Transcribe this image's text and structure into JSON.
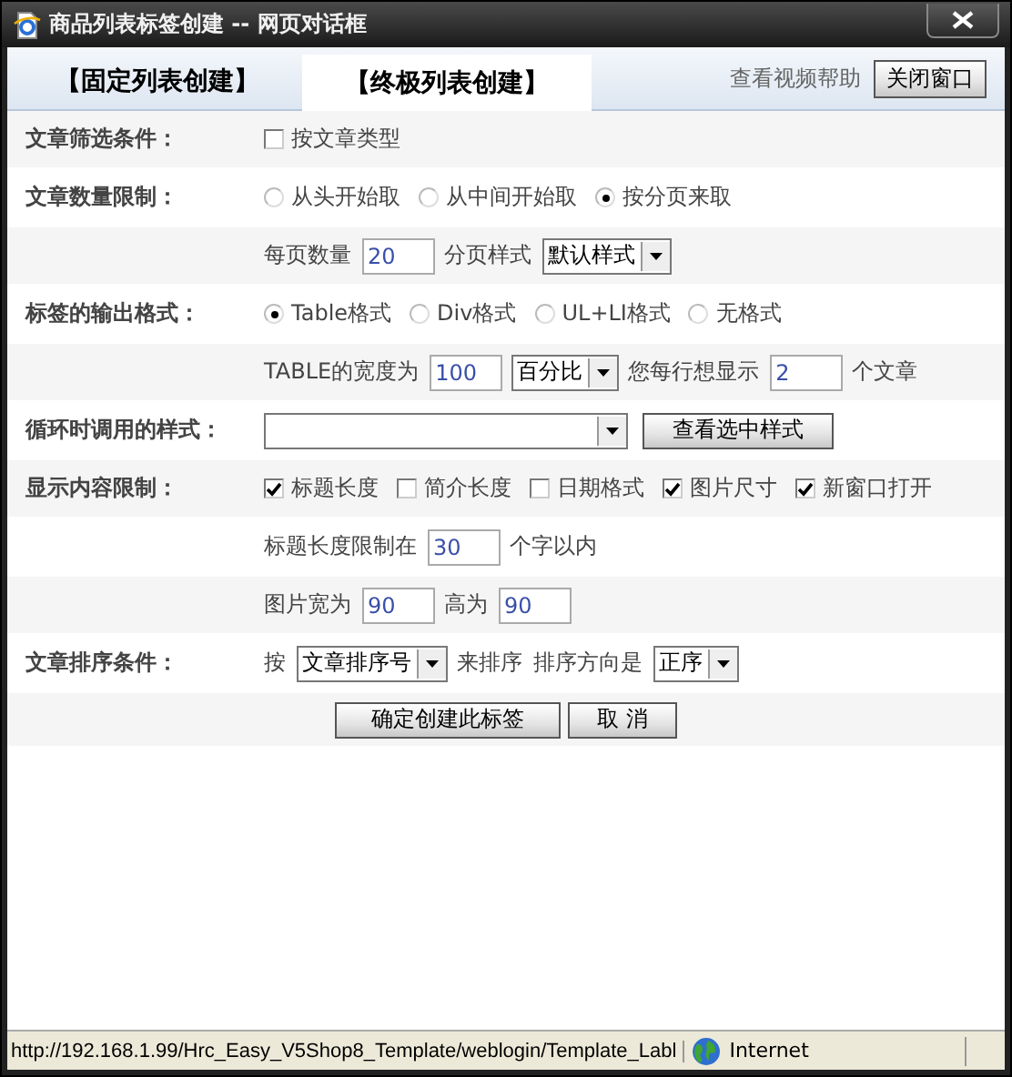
{
  "window": {
    "title": "商品列表标签创建 -- 网页对话框"
  },
  "tabs": [
    {
      "label": "【固定列表创建】",
      "selected": false
    },
    {
      "label": "【终极列表创建】",
      "selected": true
    }
  ],
  "help_link": "查看视频帮助",
  "close_window_button": "关闭窗口",
  "form_rows": [
    {
      "label": "文章筛选条件：",
      "items": [
        {
          "kind": "checkbox",
          "label": "按文章类型",
          "checked": false
        }
      ]
    },
    {
      "label": "文章数量限制：",
      "items": [
        {
          "kind": "radio",
          "label": "从头开始取",
          "selected": false
        },
        {
          "kind": "radio",
          "label": "从中间开始取",
          "selected": false
        },
        {
          "kind": "radio",
          "label": "按分页来取",
          "selected": true
        }
      ]
    },
    {
      "items": [
        {
          "kind": "text",
          "text": "每页数量"
        },
        {
          "kind": "input",
          "value": "20"
        },
        {
          "kind": "text",
          "text": "分页样式"
        },
        {
          "kind": "select",
          "value": "默认样式"
        }
      ]
    },
    {
      "label": "标签的输出格式：",
      "items": [
        {
          "kind": "radio",
          "label": "Table格式",
          "selected": true
        },
        {
          "kind": "radio",
          "label": "Div格式",
          "selected": false
        },
        {
          "kind": "radio",
          "label": "UL+LI格式",
          "selected": false
        },
        {
          "kind": "radio",
          "label": "无格式",
          "selected": false
        }
      ]
    },
    {
      "items": [
        {
          "kind": "text",
          "text": "TABLE的宽度为"
        },
        {
          "kind": "input",
          "value": "100"
        },
        {
          "kind": "select",
          "value": "百分比"
        },
        {
          "kind": "text",
          "text": "您每行想显示"
        },
        {
          "kind": "input",
          "value": "2"
        },
        {
          "kind": "text",
          "text": "个文章"
        }
      ]
    },
    {
      "label": "循环时调用的样式：",
      "items": [
        {
          "kind": "select"
        },
        {
          "kind": "button",
          "label": "查看选中样式"
        }
      ]
    },
    {
      "label": "显示内容限制：",
      "items": [
        {
          "kind": "checkbox",
          "label": "标题长度",
          "checked": true
        },
        {
          "kind": "checkbox",
          "label": "简介长度",
          "checked": false
        },
        {
          "kind": "checkbox",
          "label": "日期格式",
          "checked": false
        },
        {
          "kind": "checkbox",
          "label": "图片尺寸",
          "checked": true
        },
        {
          "kind": "checkbox",
          "label": "新窗口打开",
          "checked": true
        }
      ]
    },
    {
      "items": [
        {
          "kind": "text",
          "text": "标题长度限制在"
        },
        {
          "kind": "input",
          "value": "30"
        },
        {
          "kind": "text",
          "text": "个字以内"
        }
      ]
    },
    {
      "items": [
        {
          "kind": "text",
          "text": "图片宽为"
        },
        {
          "kind": "input",
          "value": "90"
        },
        {
          "kind": "text",
          "text": "高为"
        },
        {
          "kind": "input",
          "value": "90"
        }
      ]
    },
    {
      "label": "文章排序条件：",
      "items": [
        {
          "kind": "text",
          "text": "按"
        },
        {
          "kind": "select",
          "value": "文章排序号"
        },
        {
          "kind": "text",
          "text": "来排序"
        },
        {
          "kind": "text",
          "text": "排序方向是"
        },
        {
          "kind": "select",
          "value": "正序"
        }
      ]
    }
  ],
  "actions": [
    "确定创建此标签",
    "取 消"
  ],
  "status_bar": {
    "url": "http://192.168.1.99/Hrc_Easy_V5Shop8_Template/weblogin/Template_Labl",
    "zone": "Internet"
  }
}
